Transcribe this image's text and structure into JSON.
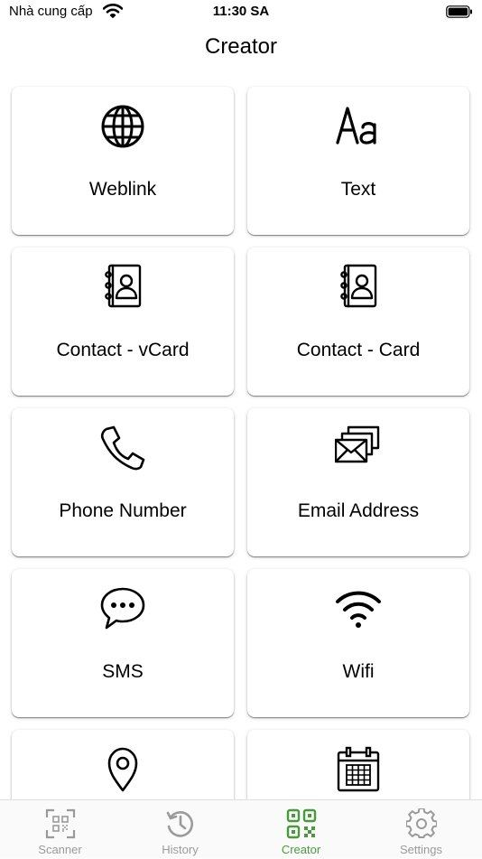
{
  "status": {
    "carrier": "Nhà cung cấp",
    "time": "11:30 SA"
  },
  "title": "Creator",
  "cards": [
    {
      "label": "Weblink",
      "icon": "globe-icon"
    },
    {
      "label": "Text",
      "icon": "text-aa-icon"
    },
    {
      "label": "Contact - vCard",
      "icon": "address-book-icon"
    },
    {
      "label": "Contact - Card",
      "icon": "address-book-icon"
    },
    {
      "label": "Phone Number",
      "icon": "phone-icon"
    },
    {
      "label": "Email Address",
      "icon": "envelopes-icon"
    },
    {
      "label": "SMS",
      "icon": "chat-bubble-icon"
    },
    {
      "label": "Wifi",
      "icon": "wifi-icon"
    },
    {
      "label": "",
      "icon": "location-pin-icon"
    },
    {
      "label": "",
      "icon": "calendar-icon"
    }
  ],
  "tabs": [
    {
      "label": "Scanner",
      "icon": "scanner-icon",
      "active": false
    },
    {
      "label": "History",
      "icon": "history-icon",
      "active": false
    },
    {
      "label": "Creator",
      "icon": "qr-code-icon",
      "active": true
    },
    {
      "label": "Settings",
      "icon": "gear-icon",
      "active": false
    }
  ],
  "colors": {
    "accent": "#4a9a3c",
    "inactive": "#9a9a9a",
    "background": "#ffffff"
  }
}
